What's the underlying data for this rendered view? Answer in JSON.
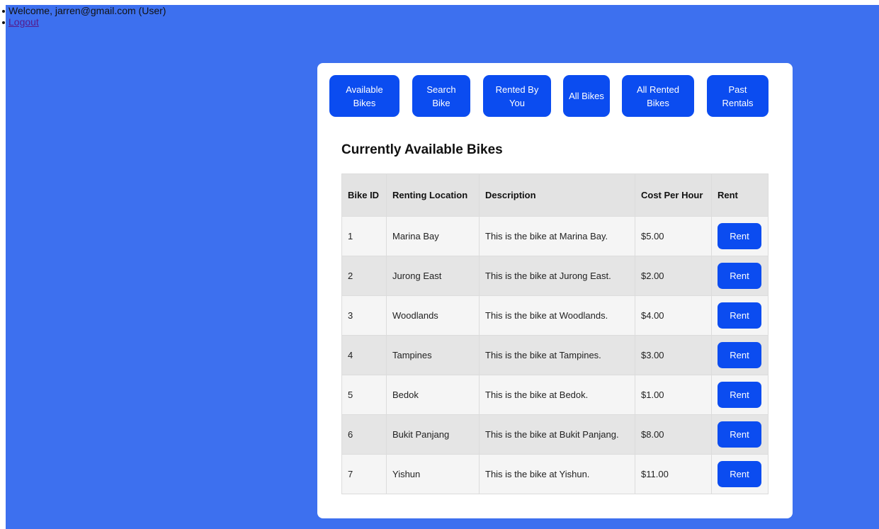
{
  "user": {
    "welcome": "Welcome, jarren@gmail.com (User)",
    "logout": "Logout"
  },
  "nav": [
    {
      "label": "Available Bikes"
    },
    {
      "label": "Search Bike"
    },
    {
      "label": "Rented By You"
    },
    {
      "label": "All Bikes"
    },
    {
      "label": "All Rented Bikes"
    },
    {
      "label": "Past Rentals"
    }
  ],
  "main": {
    "title": "Currently Available Bikes",
    "columns": [
      "Bike ID",
      "Renting Location",
      "Description",
      "Cost Per Hour",
      "Rent"
    ],
    "rows": [
      {
        "id": "1",
        "location": "Marina Bay",
        "description": "This is the bike at Marina Bay.",
        "cost": "$5.00",
        "action": "Rent"
      },
      {
        "id": "2",
        "location": "Jurong East",
        "description": "This is the bike at Jurong East.",
        "cost": "$2.00",
        "action": "Rent"
      },
      {
        "id": "3",
        "location": "Woodlands",
        "description": "This is the bike at Woodlands.",
        "cost": "$4.00",
        "action": "Rent"
      },
      {
        "id": "4",
        "location": "Tampines",
        "description": "This is the bike at Tampines.",
        "cost": "$3.00",
        "action": "Rent"
      },
      {
        "id": "5",
        "location": "Bedok",
        "description": "This is the bike at Bedok.",
        "cost": "$1.00",
        "action": "Rent"
      },
      {
        "id": "6",
        "location": "Bukit Panjang",
        "description": "This is the bike at Bukit Panjang.",
        "cost": "$8.00",
        "action": "Rent"
      },
      {
        "id": "7",
        "location": "Yishun",
        "description": "This is the bike at Yishun.",
        "cost": "$11.00",
        "action": "Rent"
      }
    ]
  },
  "colors": {
    "background": "#3d70ef",
    "button": "#0b4cf0",
    "card": "#ffffff"
  }
}
